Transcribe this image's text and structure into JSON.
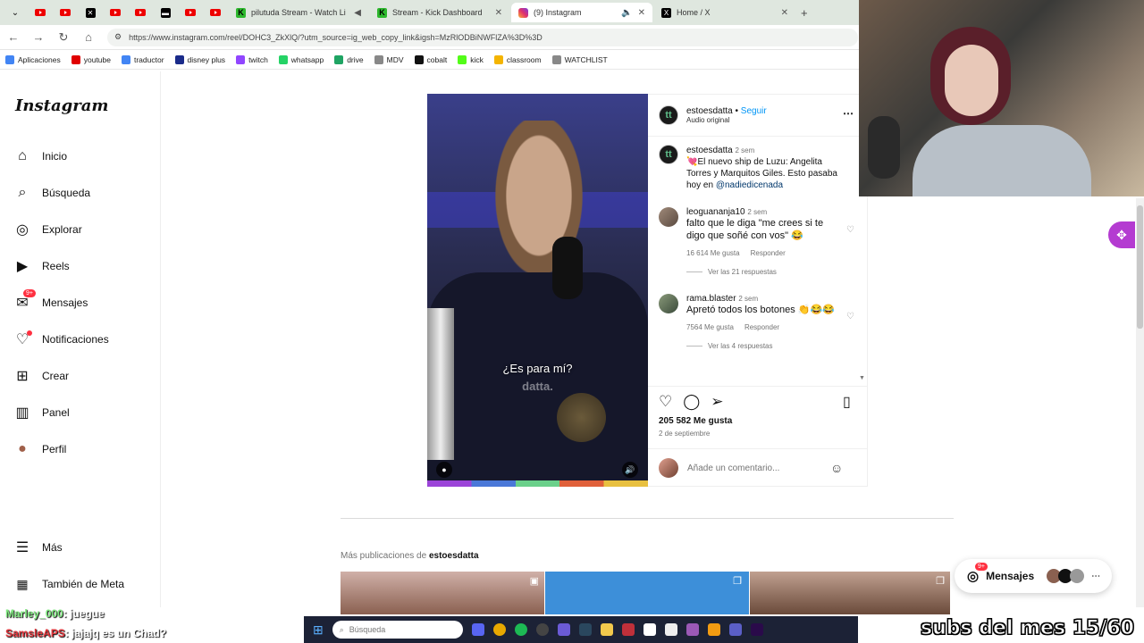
{
  "tabs": [
    {
      "label": "pilutuda Stream - Watch Li",
      "icon": "kick-icon"
    },
    {
      "label": "Stream - Kick Dashboard",
      "icon": "kick-icon"
    },
    {
      "label": "(9) Instagram",
      "icon": "instagram-icon",
      "active": true
    },
    {
      "label": "Home / X",
      "icon": "x-icon"
    }
  ],
  "address": {
    "url": "https://www.instagram.com/reel/DOHC3_ZkXlQ/?utm_source=ig_web_copy_link&igsh=MzRlODBiNWFlZA%3D%3D"
  },
  "bookmarks": [
    {
      "label": "Aplicaciones",
      "color": "#4285f4"
    },
    {
      "label": "youtube",
      "color": "#e00000"
    },
    {
      "label": "traductor",
      "color": "#4285f4"
    },
    {
      "label": "disney plus",
      "color": "#1a2b8a"
    },
    {
      "label": "twitch",
      "color": "#9146ff"
    },
    {
      "label": "whatsapp",
      "color": "#25d366"
    },
    {
      "label": "drive",
      "color": "#1fa463"
    },
    {
      "label": "MDV",
      "color": "#888888"
    },
    {
      "label": "cobalt",
      "color": "#111111"
    },
    {
      "label": "kick",
      "color": "#53fc18"
    },
    {
      "label": "classroom",
      "color": "#f4b400"
    },
    {
      "label": "WATCHLIST",
      "color": "#888888"
    }
  ],
  "sidebar": {
    "logo": "Instagram",
    "items": [
      {
        "label": "Inicio",
        "icon": "home-icon"
      },
      {
        "label": "Búsqueda",
        "icon": "search-icon"
      },
      {
        "label": "Explorar",
        "icon": "compass-icon"
      },
      {
        "label": "Reels",
        "icon": "reels-icon"
      },
      {
        "label": "Mensajes",
        "icon": "messenger-icon",
        "badge": "9+"
      },
      {
        "label": "Notificaciones",
        "icon": "heart-icon"
      },
      {
        "label": "Crear",
        "icon": "plus-icon"
      },
      {
        "label": "Panel",
        "icon": "dashboard-icon"
      },
      {
        "label": "Perfil",
        "icon": "avatar"
      }
    ],
    "more": "Más",
    "meta": "También de Meta"
  },
  "video": {
    "caption": "¿Es para mí?",
    "watermark": "datta."
  },
  "post": {
    "author": "estoesdatta",
    "follow": "Seguir",
    "audio": "Audio original",
    "caption_user": "estoesdatta",
    "caption_time": "2 sem",
    "caption_text": "💘El nuevo ship de Luzu: Angelita Torres y Marquitos Giles. Esto pasaba hoy en",
    "caption_mention": "@nadiedicenada",
    "comments": [
      {
        "user": "leoguananja10",
        "time": "2 sem",
        "text": "falto que le diga \"me crees si te digo que soñé con vos\" 😂",
        "likes": "16 614 Me gusta",
        "reply": "Responder",
        "replies": "Ver las 21 respuestas"
      },
      {
        "user": "rama.blaster",
        "time": "2 sem",
        "text": "Apretó todos los botones 👏😂😂",
        "likes": "7564 Me gusta",
        "reply": "Responder",
        "replies": "Ver las 4 respuestas"
      }
    ],
    "like_count": "205 582 Me gusta",
    "date": "2 de septiembre",
    "comment_placeholder": "Añade un comentario..."
  },
  "more_posts": {
    "prefix": "Más publicaciones de",
    "user": "estoesdatta"
  },
  "messages_pill": {
    "label": "Mensajes",
    "badge": "9+"
  },
  "chat": [
    {
      "user": "Marley_000",
      "text": ": juegue",
      "color": "#7ee87e"
    },
    {
      "user": "SamsleAPS",
      "text": ": jajajq es un Chad?",
      "color": "#e0343a"
    }
  ],
  "taskbar": {
    "search": "Búsqueda"
  },
  "overlay": {
    "subs": "subs del mes 15/60"
  }
}
